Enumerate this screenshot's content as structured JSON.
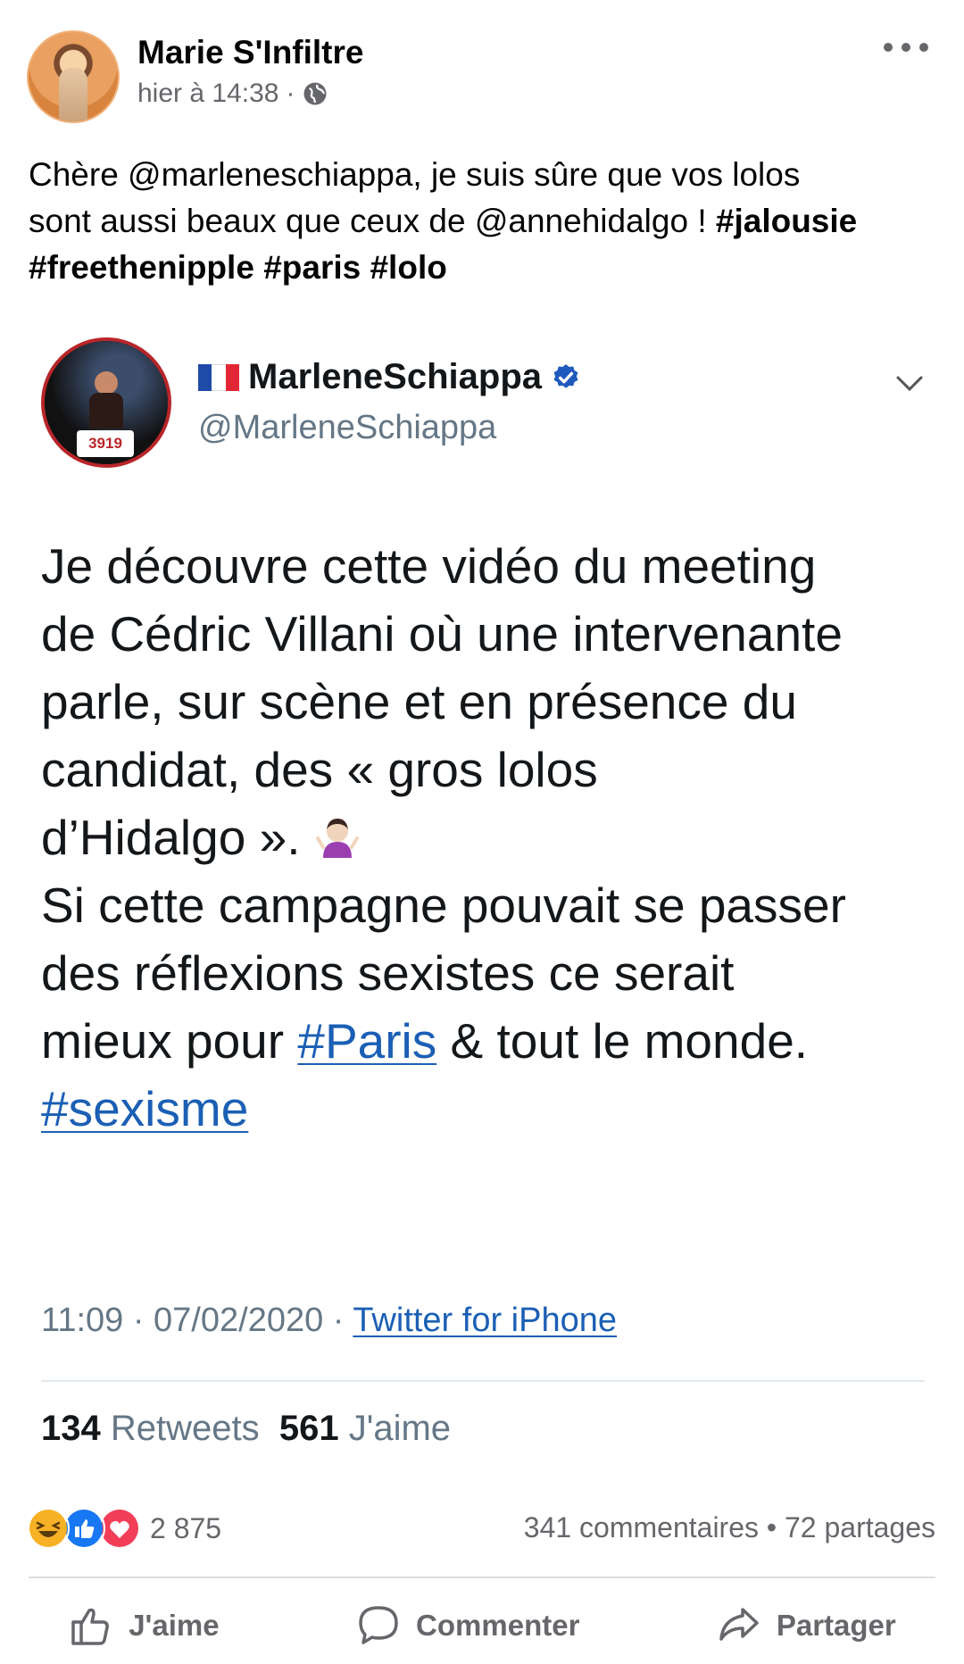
{
  "post": {
    "author": "Marie S'Infiltre",
    "timestamp": "hier à 14:38",
    "separator": "·",
    "audience_icon": "globe-icon",
    "more_icon": "more-dots-icon",
    "text_lines": [
      "Chère @marleneschiappa, je suis sûre que vos lolos",
      "sont aussi beaux que ceux de @annehidalgo ! "
    ],
    "tags": {
      "jalousie": "#jalousie",
      "freethenipple": "#freethenipple",
      "paris": "#paris",
      "lolo": "#lolo"
    }
  },
  "tweet": {
    "avatar_badge": "3919",
    "flag_icon": "france-flag-icon",
    "name": "MarleneSchiappa",
    "handle": "@MarleneSchiappa",
    "verified_icon": "verified-icon",
    "text": {
      "line1": "Je découvre cette vidéo du meeting",
      "line2": "de Cédric Villani où une intervenante",
      "line3": "parle, sur scène et en présence du",
      "line4": "candidat, des « gros lolos",
      "line5": "d’Hidalgo ». ",
      "line6": "Si cette campagne pouvait se passer",
      "line7": "des réflexions sexistes ce serait",
      "line8_before": "mieux pour ",
      "line8_link": "#Paris",
      "line8_after": " & tout le monde.",
      "line9_link": "#sexisme"
    },
    "emoji_icon": "person-shrugging-icon",
    "time": "11:09 · 07/02/2020 · ",
    "source": "Twitter for iPhone",
    "retweets_count": "134",
    "retweets_label": " Retweets",
    "likes_count": "561",
    "likes_label": " J'aime"
  },
  "reactions": {
    "icons": [
      "haha-icon",
      "like-icon",
      "love-icon"
    ],
    "count": "2 875",
    "comments": "341 commentaires",
    "dot": " • ",
    "shares": "72 partages"
  },
  "actions": {
    "like": "J'aime",
    "comment": "Commenter",
    "share": "Partager"
  },
  "colors": {
    "facebook_grey": "#65676b",
    "twitter_link": "#1b5fb5",
    "like_blue": "#1877f2",
    "love_red": "#f33e58",
    "haha_yellow": "#f7b125"
  }
}
